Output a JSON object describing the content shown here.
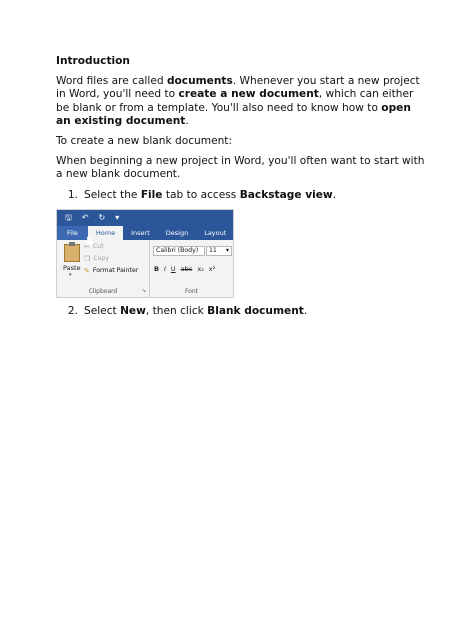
{
  "doc": {
    "heading": "Introduction",
    "p1": {
      "t1": "Word files are called ",
      "b1": "documents",
      "t2": ". Whenever you start a new project in Word, you'll need to ",
      "b2": "create a new document",
      "t3": ", which can either be blank or from a template. You'll also need to know how to ",
      "b3": "open an existing document",
      "t4": "."
    },
    "p2": "To create a new blank document:",
    "p3": "When beginning a new project in Word, you'll often want to start with a new blank document.",
    "step1": {
      "num": "1.",
      "t1": "Select the ",
      "b1": "File",
      "t2": " tab to access ",
      "b2": "Backstage view",
      "t3": "."
    },
    "step2": {
      "num": "2.",
      "t1": "Select ",
      "b1": "New",
      "t2": ", then click ",
      "b2": "Blank document",
      "t3": "."
    }
  },
  "ribbon": {
    "tabs": [
      "File",
      "Home",
      "Insert",
      "Design",
      "Layout"
    ],
    "paste": "Paste",
    "cut": "Cut",
    "copy": "Copy",
    "format_painter": "Format Painter",
    "clipboard_label": "Clipboard",
    "font_name": "Calibri (Body)",
    "font_size": "11",
    "font_label": "Font",
    "format_buttons": [
      "B",
      "I",
      "U",
      "abc",
      "x₂",
      "x²"
    ],
    "colors": {
      "ribbon_blue": "#2b579a",
      "file_tab": "#3b68b0"
    }
  }
}
